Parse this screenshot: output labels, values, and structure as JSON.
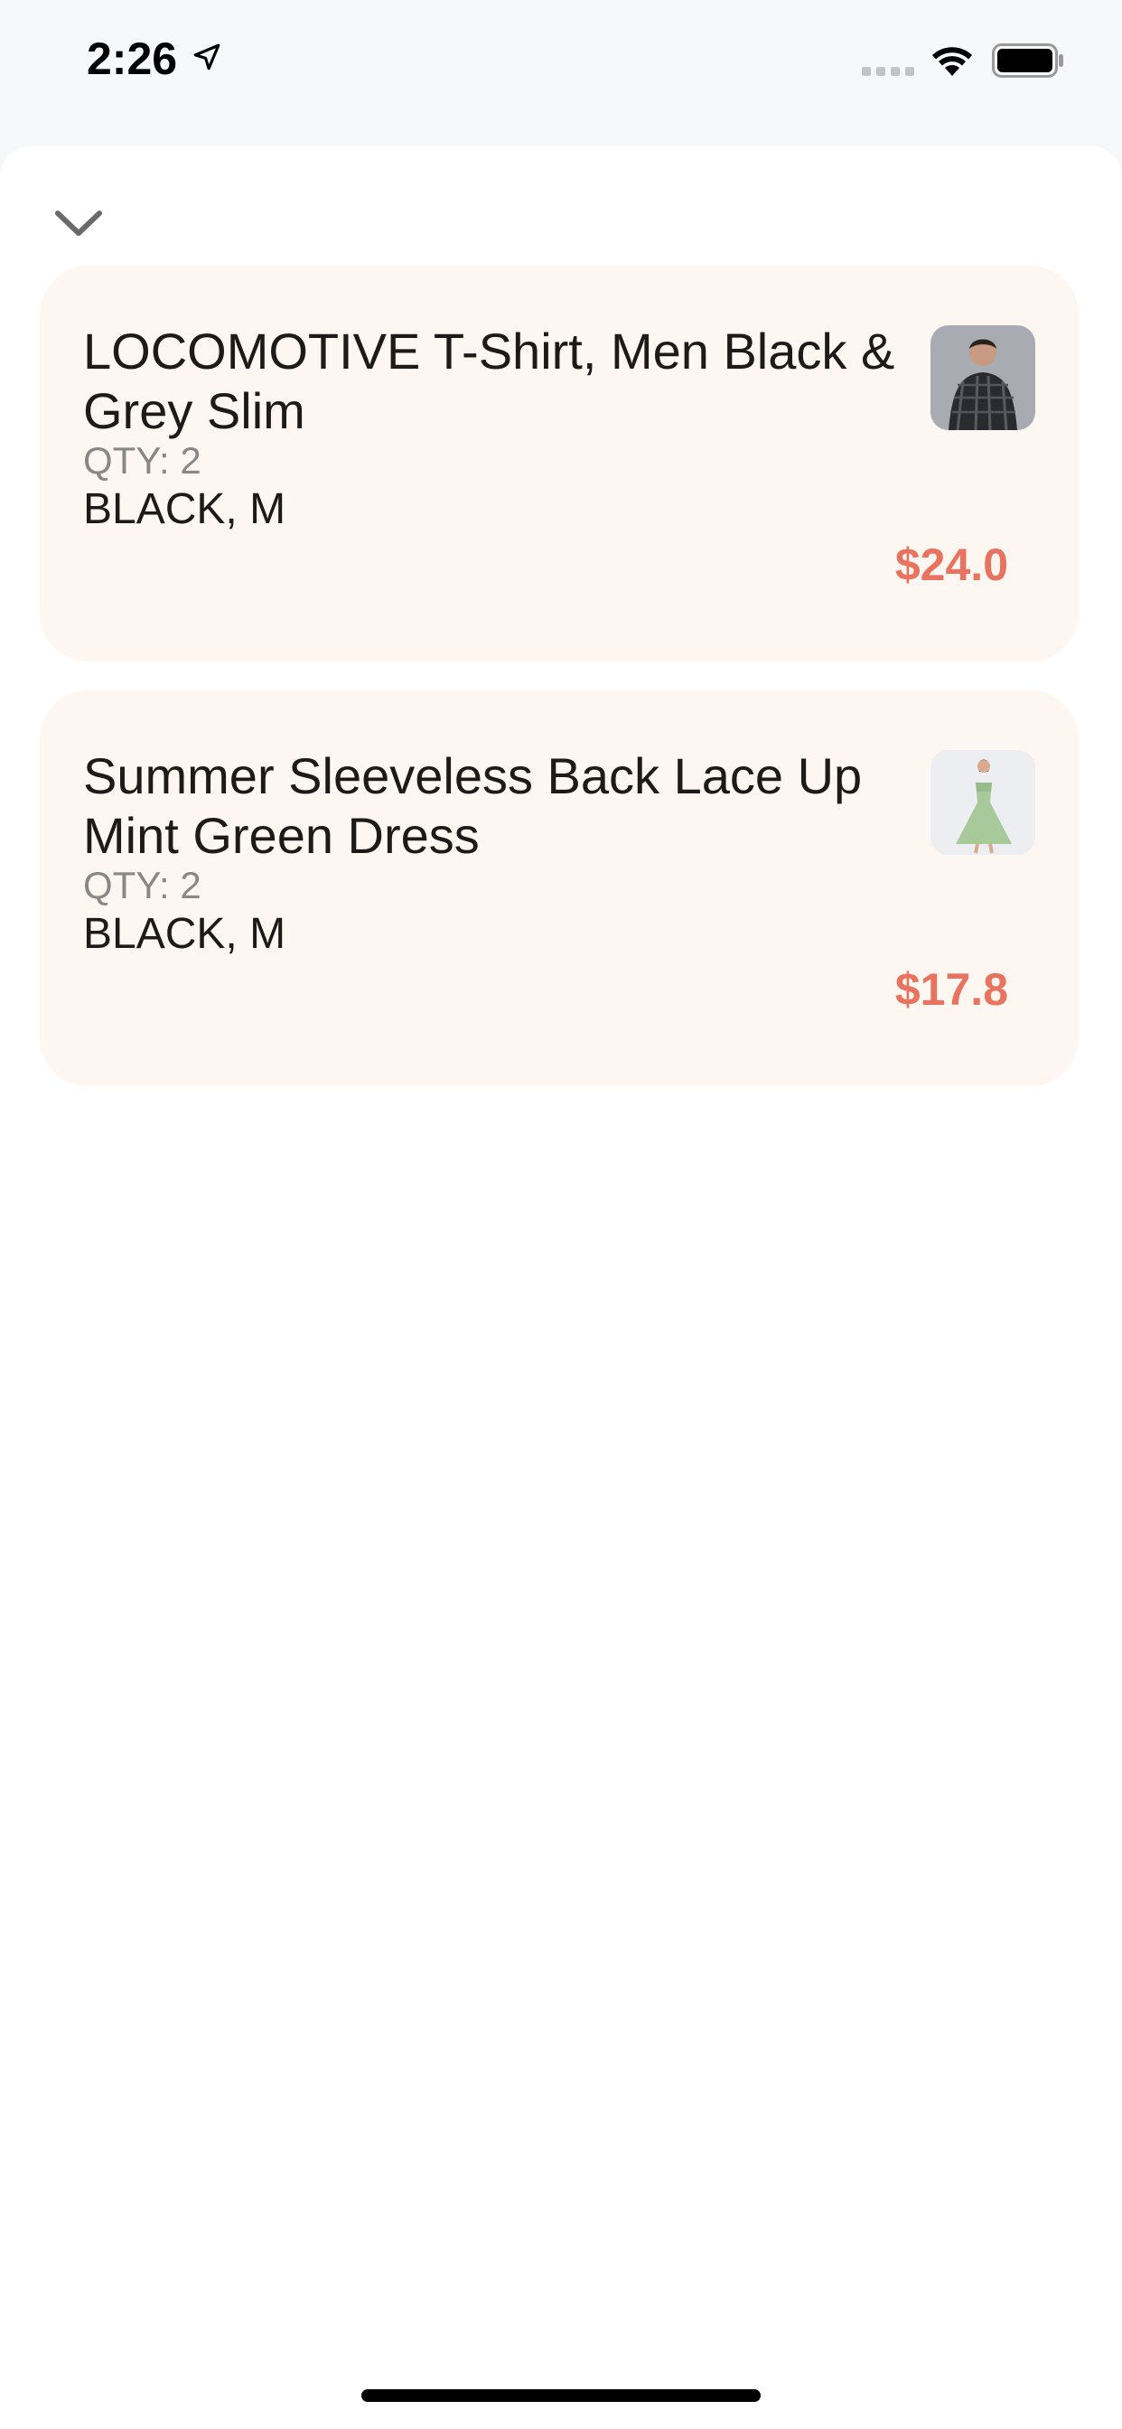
{
  "status_bar": {
    "time": "2:26",
    "icons": [
      "location-arrow-icon",
      "signal-icon",
      "wifi-icon",
      "battery-icon"
    ]
  },
  "header": {
    "collapse_icon": "chevron-down-icon"
  },
  "cart_items": [
    {
      "title": "LOCOMOTIVE T-Shirt, Men Black & Grey Slim",
      "qty_label": "QTY: 2",
      "variant": "BLACK, M",
      "price": "$24.0"
    },
    {
      "title": "Summer Sleeveless Back Lace Up Mint Green Dress",
      "qty_label": "QTY: 2",
      "variant": "BLACK, M",
      "price": "$17.8"
    }
  ],
  "colors": {
    "card_background": "#fdf6f1",
    "price": "#e8735e",
    "text_primary": "#1e1a17",
    "text_secondary": "#8a8785"
  }
}
